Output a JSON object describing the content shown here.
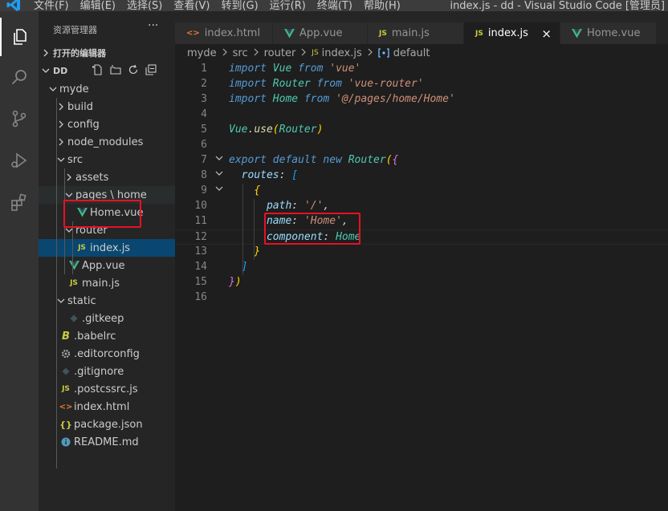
{
  "titlebar": {
    "menu": [
      "文件(F)",
      "编辑(E)",
      "选择(S)",
      "查看(V)",
      "转到(G)",
      "运行(R)",
      "终端(T)",
      "帮助(H)"
    ],
    "window_title": "index.js - dd - Visual Studio Code [管理员]"
  },
  "activity_bar": [
    "explorer-icon",
    "search-icon",
    "source-control-icon",
    "run-debug-icon",
    "extensions-icon"
  ],
  "sidebar": {
    "title": "资源管理器",
    "more": "···",
    "open_editors": "打开的编辑器",
    "workspace": "DD",
    "tree": [
      {
        "label": "myde",
        "type": "folder-open",
        "depth": 0
      },
      {
        "label": "build",
        "type": "folder",
        "depth": 1
      },
      {
        "label": "config",
        "type": "folder",
        "depth": 1
      },
      {
        "label": "node_modules",
        "type": "folder",
        "depth": 1
      },
      {
        "label": "src",
        "type": "folder-open",
        "depth": 1
      },
      {
        "label": "assets",
        "type": "folder",
        "depth": 2
      },
      {
        "label": "pages \\ home",
        "type": "folder-open",
        "depth": 2
      },
      {
        "label": "Home.vue",
        "type": "vue",
        "depth": 3
      },
      {
        "label": "router",
        "type": "folder-open",
        "depth": 2
      },
      {
        "label": "index.js",
        "type": "js",
        "depth": 3
      },
      {
        "label": "App.vue",
        "type": "vue",
        "depth": 2
      },
      {
        "label": "main.js",
        "type": "js",
        "depth": 2
      },
      {
        "label": "static",
        "type": "folder-open",
        "depth": 1
      },
      {
        "label": ".gitkeep",
        "type": "git",
        "depth": 2
      },
      {
        "label": ".babelrc",
        "type": "babel",
        "depth": 1
      },
      {
        "label": ".editorconfig",
        "type": "gear",
        "depth": 1
      },
      {
        "label": ".gitignore",
        "type": "git",
        "depth": 1
      },
      {
        "label": ".postcssrc.js",
        "type": "js",
        "depth": 1
      },
      {
        "label": "index.html",
        "type": "html",
        "depth": 1
      },
      {
        "label": "package.json",
        "type": "json",
        "depth": 1
      },
      {
        "label": "README.md",
        "type": "info",
        "depth": 1
      }
    ]
  },
  "tabs": [
    {
      "label": "index.html",
      "icon": "html",
      "active": false
    },
    {
      "label": "App.vue",
      "icon": "vue",
      "active": false
    },
    {
      "label": "main.js",
      "icon": "js",
      "active": false
    },
    {
      "label": "index.js",
      "icon": "js",
      "active": true
    },
    {
      "label": "Home.vue",
      "icon": "vue",
      "active": false
    }
  ],
  "tab_close": "×",
  "breadcrumb": [
    "myde",
    "src",
    "router",
    "index.js",
    "default"
  ],
  "editor": {
    "lines": [
      [
        [
          "kw",
          "import "
        ],
        [
          "id",
          "Vue "
        ],
        [
          "kw",
          "from "
        ],
        [
          "str",
          "'vue'"
        ]
      ],
      [
        [
          "kw",
          "import "
        ],
        [
          "id",
          "Router "
        ],
        [
          "kw",
          "from "
        ],
        [
          "str",
          "'vue-router'"
        ]
      ],
      [
        [
          "kw",
          "import "
        ],
        [
          "id",
          "Home "
        ],
        [
          "kw",
          "from "
        ],
        [
          "str",
          "'@/pages/home/Home'"
        ]
      ],
      [],
      [
        [
          "id",
          "Vue"
        ],
        [
          "pun",
          "."
        ],
        [
          "fn",
          "use"
        ],
        [
          "brk",
          "("
        ],
        [
          "id",
          "Router"
        ],
        [
          "brk",
          ")"
        ]
      ],
      [],
      [
        [
          "kw",
          "export "
        ],
        [
          "kw",
          "default "
        ],
        [
          "kw",
          "new "
        ],
        [
          "id",
          "Router"
        ],
        [
          "brk",
          "("
        ],
        [
          "brk2",
          "{"
        ]
      ],
      [
        [
          "pun",
          "  "
        ],
        [
          "prop",
          "routes"
        ],
        [
          "pun",
          ": "
        ],
        [
          "brk3",
          "["
        ]
      ],
      [
        [
          "pun",
          "    "
        ],
        [
          "brk",
          "{"
        ]
      ],
      [
        [
          "pun",
          "      "
        ],
        [
          "prop",
          "path"
        ],
        [
          "pun",
          ": "
        ],
        [
          "str",
          "'/'"
        ],
        [
          "pun",
          ","
        ]
      ],
      [
        [
          "pun",
          "      "
        ],
        [
          "prop",
          "name"
        ],
        [
          "pun",
          ": "
        ],
        [
          "str",
          "'Home'"
        ],
        [
          "pun",
          ","
        ]
      ],
      [
        [
          "pun",
          "      "
        ],
        [
          "prop",
          "component"
        ],
        [
          "pun",
          ": "
        ],
        [
          "id",
          "Home"
        ]
      ],
      [
        [
          "pun",
          "    "
        ],
        [
          "brk",
          "}"
        ]
      ],
      [
        [
          "pun",
          "  "
        ],
        [
          "brk3",
          "]"
        ]
      ],
      [
        [
          "brk2",
          "}"
        ],
        [
          "brk",
          ")"
        ]
      ],
      []
    ],
    "line_numbers": [
      "1",
      "2",
      "3",
      "4",
      "5",
      "6",
      "7",
      "8",
      "9",
      "10",
      "11",
      "12",
      "13",
      "14",
      "15",
      "16"
    ],
    "folds": {
      "6": "⌄",
      "7": "⌄",
      "8": "⌄"
    }
  }
}
